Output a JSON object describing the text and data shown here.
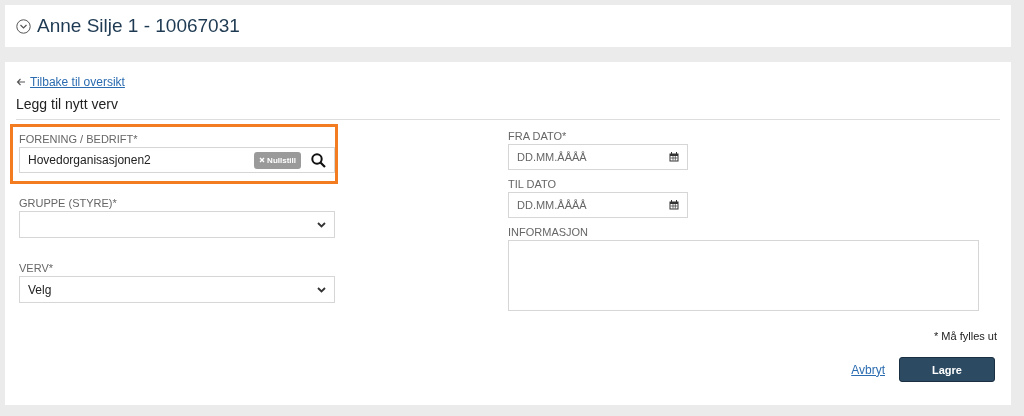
{
  "header": {
    "title": "Anne Silje 1 - 10067031",
    "expanded": false
  },
  "back_link": "Tilbake til oversikt",
  "heading": "Legg til nytt verv",
  "left_fields": [
    {
      "kind": "search",
      "label": "FORENING / BEDRIFT*",
      "value": "Hovedorganisasjonen2",
      "clear_label": "Nullstill",
      "highlighted": true
    },
    {
      "kind": "select",
      "label": "GRUPPE (STYRE)*",
      "highlighted": false
    },
    {
      "kind": "select",
      "label": "VERV*",
      "value": "Velg",
      "highlighted": false
    }
  ],
  "right_fields": [
    {
      "kind": "date",
      "label": "FRA DATO*",
      "placeholder": "DD.MM.ÅÅÅÅ"
    },
    {
      "kind": "date",
      "label": "TIL DATO",
      "placeholder": "DD.MM.ÅÅÅÅ"
    },
    {
      "kind": "textarea",
      "label": "INFORMASJON"
    }
  ],
  "required_note": "* Må fylles ut",
  "cancel_link": "Avbryt",
  "save_button": "Lagre"
}
